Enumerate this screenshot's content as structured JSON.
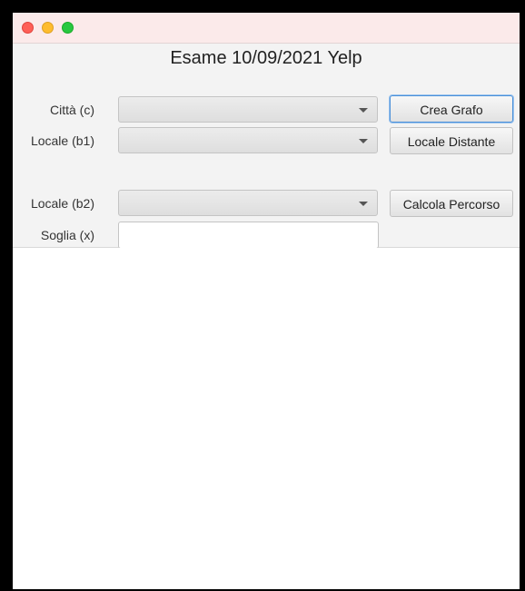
{
  "app": {
    "title": "Esame 10/09/2021 Yelp"
  },
  "form": {
    "citta_label": "Città (c)",
    "locale_b1_label": "Locale (b1)",
    "locale_b2_label": "Locale (b2)",
    "soglia_label": "Soglia (x)",
    "citta_value": "",
    "locale_b1_value": "",
    "locale_b2_value": "",
    "soglia_value": ""
  },
  "buttons": {
    "crea_grafo": "Crea Grafo",
    "locale_distante": "Locale Distante",
    "calcola_percorso": "Calcola Percorso"
  },
  "output": {
    "text": ""
  }
}
